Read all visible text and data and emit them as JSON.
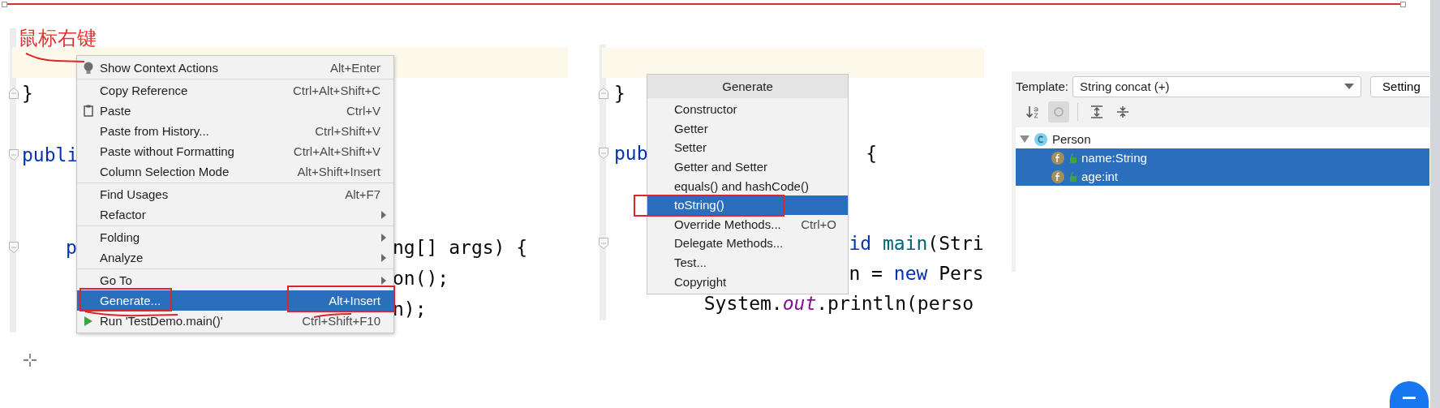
{
  "annotation": {
    "text": "鼠标右键"
  },
  "left_editor": {
    "lines": [
      {
        "kind": "blank",
        "current": true
      },
      {
        "kind": "closer",
        "current": false,
        "segments": [
          {
            "tokens": [
              {
                "text": "}",
                "kind": "plain"
              }
            ]
          }
        ]
      },
      {
        "kind": "blank",
        "current": false
      },
      {
        "kind": "opener",
        "current": false,
        "segments": [
          {
            "tokens": [
              {
                "text": "publi",
                "kind": "keyword"
              }
            ]
          }
        ]
      },
      {
        "kind": "blank",
        "current": false
      },
      {
        "kind": "blank",
        "current": false
      },
      {
        "kind": "opener",
        "current": false,
        "segments": [
          {
            "tokens": [
              {
                "text": "p",
                "kind": "keyword"
              }
            ]
          },
          {
            "tokens": [
              {
                "text": "ng[] args) {",
                "kind": "plain"
              }
            ]
          }
        ]
      },
      {
        "kind": "code",
        "current": false,
        "segments": [
          {
            "tokens": [
              {
                "text": "on();",
                "kind": "plain"
              }
            ]
          }
        ]
      },
      {
        "kind": "code",
        "current": false,
        "segments": [
          {
            "tokens": [
              {
                "text": "n);",
                "kind": "plain"
              }
            ]
          }
        ]
      }
    ]
  },
  "context_menu": {
    "groups": [
      [
        {
          "label": "Show Context Actions",
          "shortcut": "Alt+Enter",
          "submenu": false,
          "selected": false,
          "annotated": false
        }
      ],
      [
        {
          "label": "Copy Reference",
          "shortcut": "Ctrl+Alt+Shift+C",
          "submenu": false,
          "selected": false,
          "annotated": false
        },
        {
          "label": "Paste",
          "shortcut": "Ctrl+V",
          "submenu": false,
          "selected": false,
          "annotated": false
        },
        {
          "label": "Paste from History...",
          "shortcut": "Ctrl+Shift+V",
          "submenu": false,
          "selected": false,
          "annotated": false
        },
        {
          "label": "Paste without Formatting",
          "shortcut": "Ctrl+Alt+Shift+V",
          "submenu": false,
          "selected": false,
          "annotated": false
        },
        {
          "label": "Column Selection Mode",
          "shortcut": "Alt+Shift+Insert",
          "submenu": false,
          "selected": false,
          "annotated": false
        }
      ],
      [
        {
          "label": "Find Usages",
          "shortcut": "Alt+F7",
          "submenu": false,
          "selected": false,
          "annotated": false
        },
        {
          "label": "Refactor",
          "submenu": true,
          "selected": false,
          "annotated": false
        }
      ],
      [
        {
          "label": "Folding",
          "submenu": true,
          "selected": false,
          "annotated": false
        },
        {
          "label": "Analyze",
          "submenu": true,
          "selected": false,
          "annotated": false
        }
      ],
      [
        {
          "label": "Go To",
          "submenu": true,
          "selected": false,
          "annotated": false
        },
        {
          "label": "Generate...",
          "shortcut": "Alt+Insert",
          "submenu": false,
          "selected": true,
          "annotated": true
        },
        {
          "label": "Run 'TestDemo.main()'",
          "shortcut": "Ctrl+Shift+F10",
          "submenu": false,
          "selected": false,
          "annotated": false
        }
      ]
    ]
  },
  "middle_editor": {
    "lines": [
      {
        "kind": "blank",
        "current": true
      },
      {
        "kind": "closer",
        "current": false,
        "segments": [
          {
            "tokens": [
              {
                "text": "}",
                "kind": "plain"
              }
            ]
          }
        ]
      },
      {
        "kind": "blank",
        "current": false
      },
      {
        "kind": "opener",
        "current": false,
        "segments": [
          {
            "tokens": [
              {
                "text": "pub",
                "kind": "keyword"
              }
            ]
          },
          {
            "tokens": [
              {
                "text": "{",
                "kind": "plain"
              }
            ]
          }
        ]
      },
      {
        "kind": "blank",
        "current": false
      },
      {
        "kind": "blank",
        "current": false
      },
      {
        "kind": "opener",
        "current": false,
        "segments": [
          {
            "tokens": [
              {
                "text": "id",
                "kind": "keyword"
              },
              {
                "text": " main",
                "kind": "method"
              },
              {
                "text": "(Stri",
                "kind": "plain"
              }
            ]
          }
        ]
      },
      {
        "kind": "code",
        "current": false,
        "segments": [
          {
            "tokens": [
              {
                "text": "n = ",
                "kind": "plain"
              },
              {
                "text": "new",
                "kind": "keyword"
              },
              {
                "text": " Pers",
                "kind": "plain"
              }
            ]
          }
        ]
      },
      {
        "kind": "code",
        "current": false,
        "segments": [
          {
            "tokens": [
              {
                "text": "System.",
                "kind": "plain"
              },
              {
                "text": "out",
                "kind": "field"
              },
              {
                "text": ".println(perso",
                "kind": "plain"
              }
            ]
          }
        ]
      }
    ]
  },
  "generate_popup": {
    "title": "Generate",
    "items": [
      {
        "label": "Constructor",
        "selected": false,
        "annotated": false
      },
      {
        "label": "Getter",
        "selected": false,
        "annotated": false
      },
      {
        "label": "Setter",
        "selected": false,
        "annotated": false
      },
      {
        "label": "Getter and Setter",
        "selected": false,
        "annotated": false
      },
      {
        "label": "equals() and hashCode()",
        "selected": false,
        "annotated": false
      },
      {
        "label": "toString()",
        "selected": true,
        "annotated": true
      },
      {
        "label": "Override Methods...",
        "shortcut": "Ctrl+O",
        "selected": false,
        "annotated": false
      },
      {
        "label": "Delegate Methods...",
        "selected": false,
        "annotated": false
      },
      {
        "label": "Test...",
        "selected": false,
        "annotated": false
      },
      {
        "label": "Copyright",
        "selected": false,
        "annotated": false
      }
    ]
  },
  "tostring_dialog": {
    "template_label": "Template:",
    "template_value": "String concat (+)",
    "settings_button": "Setting",
    "toolbar": [
      {
        "pressed": false
      },
      {
        "pressed": true
      },
      {
        "pressed": false
      },
      {
        "pressed": false
      }
    ],
    "tree": [
      {
        "label": "Person",
        "expanded": true,
        "selected": false,
        "children": [
          {
            "label": "name:String",
            "selected": true
          },
          {
            "label": "age:int",
            "selected": true
          }
        ]
      }
    ]
  }
}
